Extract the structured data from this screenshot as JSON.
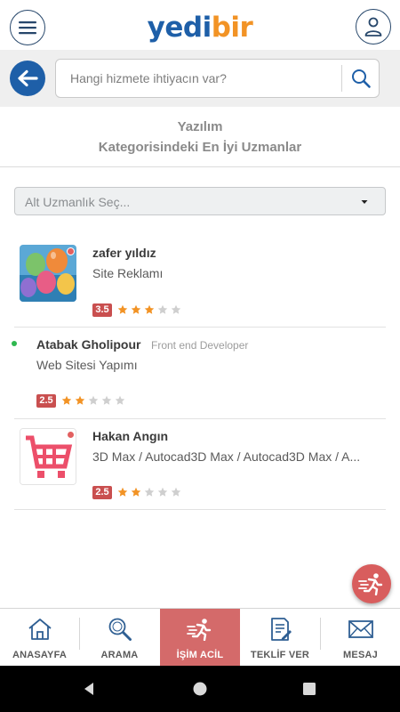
{
  "header": {
    "logo_part1": "yedi",
    "logo_part2": "bir",
    "menu_icon": "hamburger-icon",
    "user_icon": "user-icon",
    "colors": {
      "brand_blue": "#1e5fa8",
      "brand_orange": "#f29325"
    }
  },
  "search": {
    "placeholder": "Hangi hizmete ihtiyacın var?",
    "back_icon": "arrow-left-icon",
    "search_icon": "search-icon"
  },
  "heading": {
    "line1": "Yazılım",
    "line2": "Kategorisindeki En İyi Uzmanlar"
  },
  "filter": {
    "selected": "Alt Uzmanlık Seç...",
    "caret_icon": "chevron-down-icon"
  },
  "experts": [
    {
      "name": "zafer yıldız",
      "role": "",
      "service": "Site Reklamı",
      "rating": "3.5",
      "stars_filled": 3,
      "stars_total": 5,
      "avatar": "balloons-image",
      "online": false
    },
    {
      "name": "Atabak Gholipour",
      "role": "Front end Developer",
      "service": "Web Sitesi Yapımı",
      "rating": "2.5",
      "stars_filled": 2,
      "stars_total": 5,
      "avatar": "",
      "online": true
    },
    {
      "name": "Hakan Angın",
      "role": "",
      "service": "3D Max / Autocad3D Max / Autocad3D Max / A...",
      "rating": "2.5",
      "stars_filled": 2,
      "stars_total": 5,
      "avatar": "shopping-cart-image",
      "online": false
    }
  ],
  "fab": {
    "icon": "running-person-icon",
    "color": "#d85d5d"
  },
  "bottom_nav": [
    {
      "label": "ANASAYFA",
      "icon": "home-icon",
      "active": false
    },
    {
      "label": "ARAMA",
      "icon": "search-icon",
      "active": false
    },
    {
      "label": "İŞİM ACİL",
      "icon": "running-person-icon",
      "active": true
    },
    {
      "label": "TEKLİF VER",
      "icon": "document-edit-icon",
      "active": false
    },
    {
      "label": "MESAJ",
      "icon": "envelope-icon",
      "active": false
    }
  ],
  "system_nav": {
    "back_icon": "triangle-back-icon",
    "home_icon": "circle-home-icon",
    "recents_icon": "square-recents-icon"
  },
  "colors": {
    "star_filled": "#f29325",
    "star_empty": "#cfcfcf",
    "rating_badge": "#c94f4f",
    "active_tab": "#d46a6a"
  }
}
